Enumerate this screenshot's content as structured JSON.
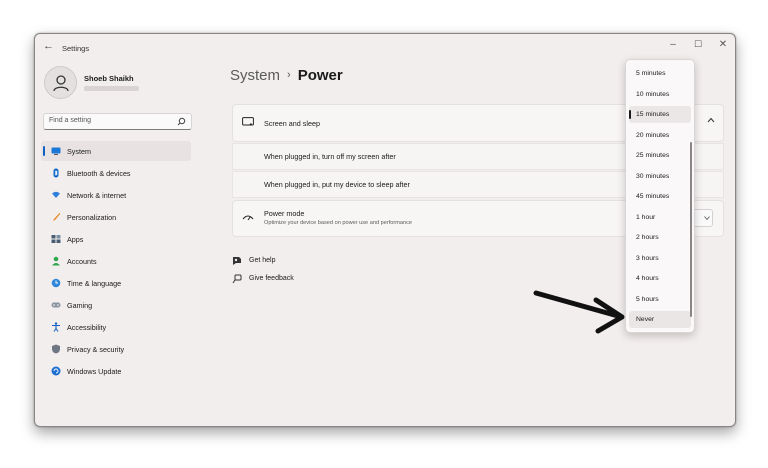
{
  "window": {
    "title": "Settings",
    "back_glyph": "←",
    "min_glyph": "–",
    "max_glyph": "☐",
    "close_glyph": "✕"
  },
  "profile": {
    "name": "Shoeb Shaikh"
  },
  "search": {
    "placeholder": "Find a setting"
  },
  "nav": {
    "items": [
      {
        "label": "System",
        "icon": "system-icon"
      },
      {
        "label": "Bluetooth & devices",
        "icon": "bluetooth-icon"
      },
      {
        "label": "Network & internet",
        "icon": "network-icon"
      },
      {
        "label": "Personalization",
        "icon": "personalization-icon"
      },
      {
        "label": "Apps",
        "icon": "apps-icon"
      },
      {
        "label": "Accounts",
        "icon": "accounts-icon"
      },
      {
        "label": "Time & language",
        "icon": "time-language-icon"
      },
      {
        "label": "Gaming",
        "icon": "gaming-icon"
      },
      {
        "label": "Accessibility",
        "icon": "accessibility-icon"
      },
      {
        "label": "Privacy & security",
        "icon": "privacy-icon"
      },
      {
        "label": "Windows Update",
        "icon": "windows-update-icon"
      }
    ],
    "active": "System"
  },
  "breadcrumb": {
    "parent": "System",
    "separator": "›",
    "current": "Power"
  },
  "screen_sleep": {
    "title": "Screen and sleep",
    "rows": [
      {
        "label": "When plugged in, turn off my screen after"
      },
      {
        "label": "When plugged in, put my device to sleep after"
      }
    ]
  },
  "power_mode": {
    "title": "Power mode",
    "description": "Optimize your device based on power use and performance"
  },
  "help": {
    "get_help": "Get help",
    "give_feedback": "Give feedback"
  },
  "dropdown": {
    "options": [
      "5 minutes",
      "10 minutes",
      "15 minutes",
      "20 minutes",
      "25 minutes",
      "30 minutes",
      "45 minutes",
      "1 hour",
      "2 hours",
      "3 hours",
      "4 hours",
      "5 hours",
      "Never"
    ],
    "selected": "15 minutes",
    "hovered": "Never"
  },
  "colors": {
    "accent": "#1061c6",
    "window_bg": "#f3eeee"
  }
}
